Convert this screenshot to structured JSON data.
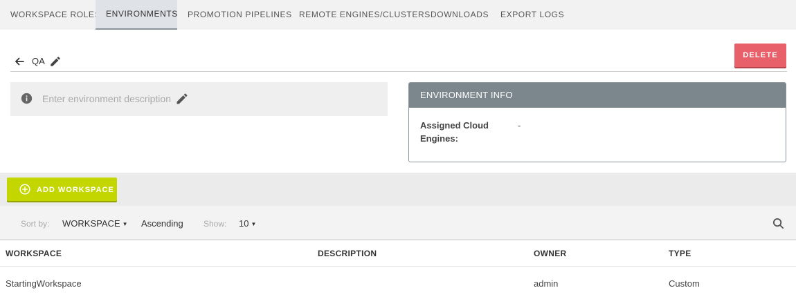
{
  "tabs": [
    {
      "label": "WORKSPACE ROLES",
      "active": false
    },
    {
      "label": "ENVIRONMENTS",
      "active": true
    },
    {
      "label": "PROMOTION PIPELINES",
      "active": false
    },
    {
      "label": "REMOTE ENGINES/CLUSTERS",
      "active": false
    },
    {
      "label": "DOWNLOADS",
      "active": false
    },
    {
      "label": "EXPORT LOGS",
      "active": false
    }
  ],
  "header": {
    "env_name": "QA",
    "delete_label": "DELETE"
  },
  "description": {
    "placeholder": "Enter environment description"
  },
  "env_info": {
    "title": "ENVIRONMENT INFO",
    "assigned_label": "Assigned Cloud Engines:",
    "assigned_value": "-"
  },
  "workspaces": {
    "add_label": "ADD WORKSPACE",
    "sort_by_label": "Sort by:",
    "sort_by_value": "WORKSPACE",
    "order_value": "Ascending",
    "show_label": "Show:",
    "show_value": "10",
    "columns": [
      "WORKSPACE",
      "DESCRIPTION",
      "OWNER",
      "TYPE"
    ],
    "rows": [
      {
        "workspace": "StartingWorkspace",
        "description": "",
        "owner": "admin",
        "type": "Custom"
      }
    ]
  },
  "colors": {
    "delete": "#e8606a",
    "add_workspace": "#c3d600",
    "card_header": "#7c868d"
  },
  "icons": [
    "back-arrow-icon",
    "pencil-icon",
    "info-icon",
    "plus-circle-icon",
    "search-icon",
    "caret-down-icon"
  ]
}
